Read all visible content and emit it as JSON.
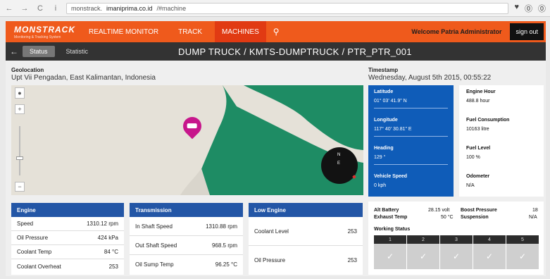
{
  "browser": {
    "back_icon": "←",
    "forward_icon": "→",
    "reload_icon": "C",
    "info_icon": "i",
    "url_prefix": "monstrack.",
    "url_domain": "imaniprima.co.id",
    "url_path": "/#machine",
    "heart_icon": "♥",
    "shield_icon": "⓪",
    "user_icon": "⓪"
  },
  "nav": {
    "logo_name": "MONSTRACK",
    "logo_sub": "Monitoring & Tracking System",
    "items": [
      {
        "label": "Realtime Monitor"
      },
      {
        "label": "Track"
      },
      {
        "label": "Machines"
      }
    ],
    "search_icon": "⚲",
    "welcome": "Welcome Patria Administrator",
    "signout": "sign out"
  },
  "subbar": {
    "back_icon": "←",
    "tabs": [
      {
        "label": "Status"
      },
      {
        "label": "Statistic"
      }
    ],
    "title": "DUMP TRUCK / KMTS-DUMPTRUCK / PTR_PTR_001"
  },
  "geo": {
    "label": "Geolocation",
    "value": "Upt Vii Pengadan, East Kalimantan, Indonesia"
  },
  "timestamp": {
    "label": "Timestamp",
    "value": "Wednesday, August 5th 2015, 00:55:22"
  },
  "map": {
    "zoom_in": "+",
    "zoom_out": "−",
    "compass_n": "N",
    "compass_e": "E"
  },
  "blue": {
    "latitude": {
      "label": "Latitude",
      "value": "01° 03' 41.9\" N"
    },
    "longitude": {
      "label": "Longitude",
      "value": "117° 40' 30.81\" E"
    },
    "heading": {
      "label": "Heading",
      "value": "129 °"
    },
    "speed": {
      "label": "Vehicle Speed",
      "value": "0 kph"
    }
  },
  "white": {
    "engine_hour": {
      "label": "Engine Hour",
      "value": "488.8 hour"
    },
    "fuel_cons": {
      "label": "Fuel Consumption",
      "value": "10163 litre"
    },
    "fuel_level": {
      "label": "Fuel Level",
      "value": "100 %"
    },
    "odometer": {
      "label": "Odometer",
      "value": "N/A"
    }
  },
  "engine": {
    "title": "Engine",
    "rows": [
      {
        "k": "Speed",
        "v": "1310.12 rpm"
      },
      {
        "k": "Oil Pressure",
        "v": "424 kPa"
      },
      {
        "k": "Coolant Temp",
        "v": "84 °C"
      },
      {
        "k": "Coolant Overheat",
        "v": "253"
      }
    ]
  },
  "transmission": {
    "title": "Transmission",
    "rows": [
      {
        "k": "In Shaft Speed",
        "v": "1310.88 rpm"
      },
      {
        "k": "Out Shaft Speed",
        "v": "968.5 rpm"
      },
      {
        "k": "Oil Sump Temp",
        "v": "96.25 °C"
      }
    ]
  },
  "low_engine": {
    "title": "Low Engine",
    "rows": [
      {
        "k": "Coolant Level",
        "v": "253"
      },
      {
        "k": "Oil Pressure",
        "v": "253"
      }
    ]
  },
  "status": {
    "alt_battery": {
      "label": "Alt Battery",
      "value": "28.15 volt"
    },
    "exhaust_temp": {
      "label": "Exhaust Temp",
      "value": "50 °C"
    },
    "boost_pressure": {
      "label": "Boost Pressure",
      "value": "18"
    },
    "suspension": {
      "label": "Suspension",
      "value": "N/A"
    },
    "working_status_label": "Working Status",
    "working": [
      {
        "num": "1",
        "icon": "✓"
      },
      {
        "num": "2",
        "icon": "✓"
      },
      {
        "num": "3",
        "icon": "✓"
      },
      {
        "num": "4",
        "icon": "✓"
      },
      {
        "num": "5",
        "icon": "✓"
      }
    ]
  },
  "colors": {
    "nav_orange": "#ef5a1c",
    "accent_blue": "#2356a6",
    "map_green": "#1e8c64",
    "dark_bar": "#333333"
  }
}
